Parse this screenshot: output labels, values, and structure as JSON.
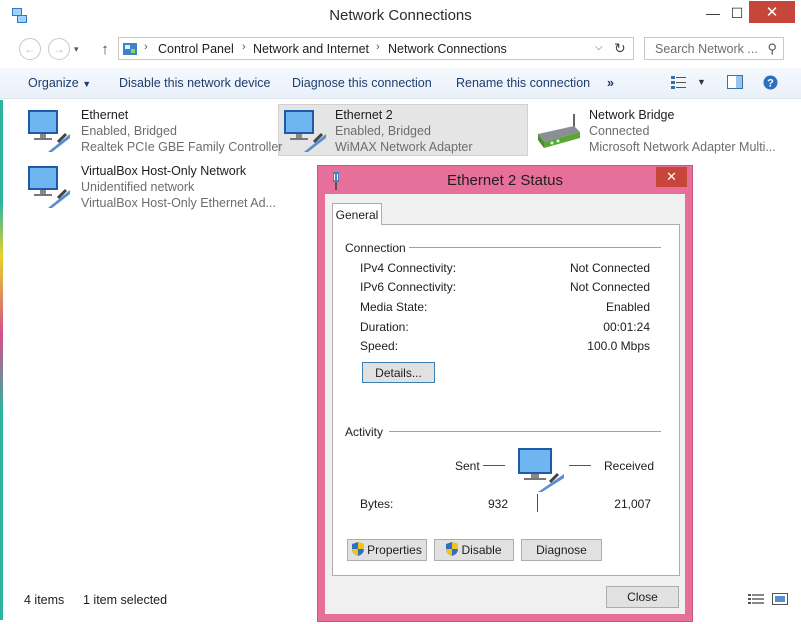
{
  "window": {
    "title": "Network Connections"
  },
  "address": {
    "crumbs": [
      "Control Panel",
      "Network and Internet",
      "Network Connections"
    ],
    "search_placeholder": "Search Network ..."
  },
  "toolbar": {
    "organize": "Organize",
    "disable": "Disable this network device",
    "diagnose": "Diagnose this connection",
    "rename": "Rename this connection",
    "more": "»"
  },
  "items": [
    {
      "name": "Ethernet",
      "status": "Enabled, Bridged",
      "device": "Realtek PCIe GBE Family Controller"
    },
    {
      "name": "Ethernet 2",
      "status": "Enabled, Bridged",
      "device": "WiMAX Network Adapter"
    },
    {
      "name": "Network Bridge",
      "status": "Connected",
      "device": "Microsoft Network Adapter Multi..."
    },
    {
      "name": "VirtualBox Host-Only Network",
      "status": "Unidentified network",
      "device": "VirtualBox Host-Only Ethernet Ad..."
    }
  ],
  "statusbar": {
    "count": "4 items",
    "selected": "1 item selected"
  },
  "dialog": {
    "title": "Ethernet 2 Status",
    "tab": "General",
    "connection_group": "Connection",
    "rows": [
      {
        "label": "IPv4 Connectivity:",
        "value": "Not Connected"
      },
      {
        "label": "IPv6 Connectivity:",
        "value": "Not Connected"
      },
      {
        "label": "Media State:",
        "value": "Enabled"
      },
      {
        "label": "Duration:",
        "value": "00:01:24"
      },
      {
        "label": "Speed:",
        "value": "100.0 Mbps"
      }
    ],
    "details_btn": "Details...",
    "activity_group": "Activity",
    "sent_label": "Sent",
    "received_label": "Received",
    "bytes_label": "Bytes:",
    "bytes_sent": "932",
    "bytes_received": "21,007",
    "properties_btn": "Properties",
    "disable_btn": "Disable",
    "diagnose_btn": "Diagnose",
    "close_btn": "Close"
  },
  "colors": {
    "accent_close": "#c7463a",
    "dialog_frame": "#e7709a"
  }
}
